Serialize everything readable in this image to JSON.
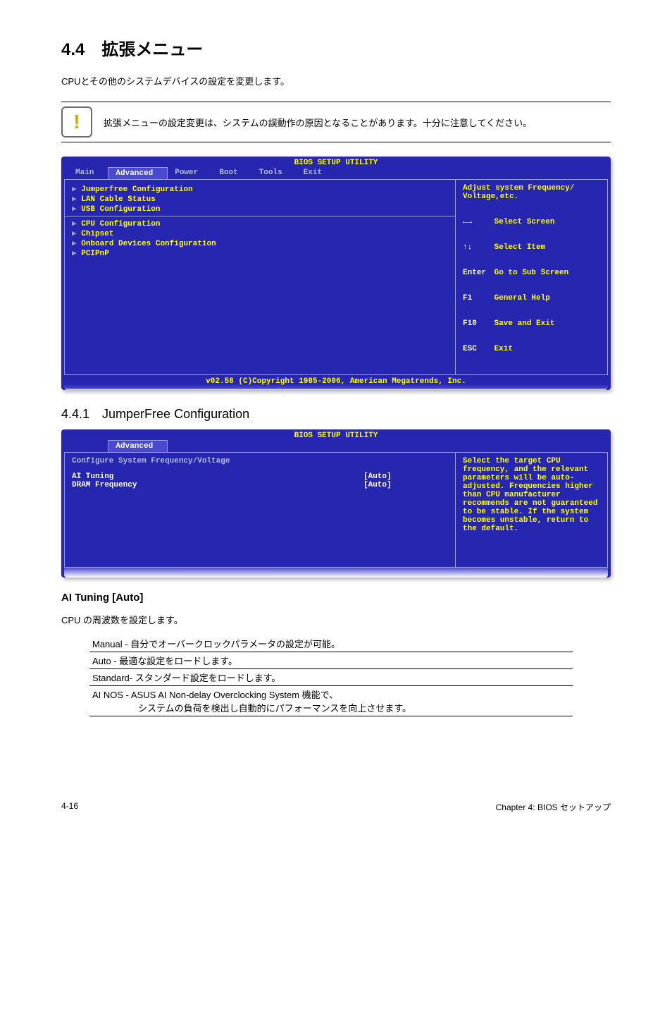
{
  "heading": "4.4　拡張メニュー",
  "intro": "CPUとその他のシステムデバイスの設定を変更します。",
  "warning": "拡張メニューの設定変更は、システムの誤動作の原因となることがあります。十分に注意してください。",
  "bios1": {
    "title": "BIOS SETUP UTILITY",
    "menu": [
      "Main",
      "Advanced",
      "Power",
      "Boot",
      "Tools",
      "Exit"
    ],
    "active": "Advanced",
    "group1": [
      "Jumperfree Configuration",
      "LAN Cable Status",
      "USB Configuration"
    ],
    "group2": [
      "CPU Configuration",
      "Chipset",
      "Onboard Devices Configuration",
      "PCIPnP"
    ],
    "help": "Adjust system Frequency/\nVoltage,etc.",
    "keys": [
      {
        "k": "←→",
        "d": "Select Screen"
      },
      {
        "k": "↑↓",
        "d": "Select Item"
      },
      {
        "k": "Enter",
        "d": "Go to Sub Screen"
      },
      {
        "k": "F1",
        "d": "General Help"
      },
      {
        "k": "F10",
        "d": "Save and Exit"
      },
      {
        "k": "ESC",
        "d": "Exit"
      }
    ],
    "footer": "v02.58 (C)Copyright 1985-2006, American Megatrends, Inc."
  },
  "section441": "4.4.1　JumperFree Configuration",
  "bios2": {
    "title": "BIOS SETUP UTILITY",
    "active": "Advanced",
    "header": "Configure System Frequency/Voltage",
    "rows": [
      {
        "name": "AI Tuning",
        "val": "[Auto]"
      },
      {
        "name": "DRAM Frequency",
        "val": "[Auto]"
      }
    ],
    "help": "Select the target CPU frequency, and the relevant parameters will be auto-adjusted. Frequencies higher than CPU manufacturer recommends are not guaranteed to be stable. If the system becomes unstable, return to the default."
  },
  "ai_tuning_heading": "AI Tuning [Auto]",
  "ai_tuning_desc": "CPU の周波数を設定します。",
  "options": [
    "Manual - 自分でオーバークロックパラメータの設定が可能。",
    "Auto - 最適な設定をロードします。",
    "Standard- スタンダード設定をロードします。",
    "AI NOS - ASUS AI Non-delay Overclocking System 機能で、\n　　　　　システムの負荷を検出し自動的にパフォーマンスを向上させます。"
  ],
  "page_left": "4-16",
  "page_right": "Chapter 4: BIOS セットアップ"
}
